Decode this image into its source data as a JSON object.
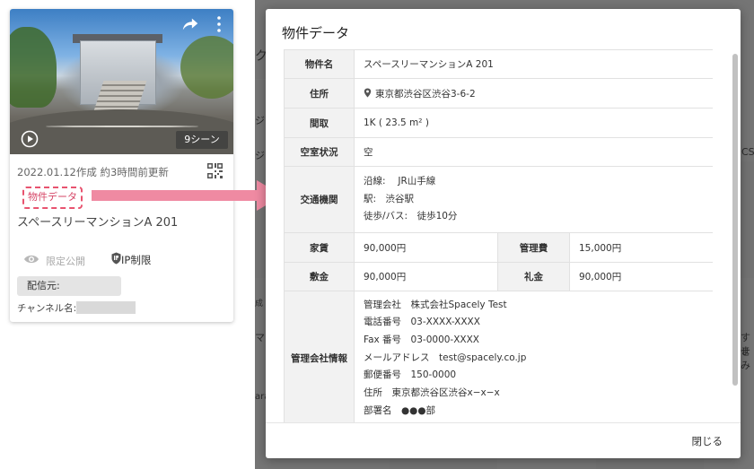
{
  "card": {
    "scene_count": "9シーン",
    "meta": "2022.01.12作成 約3時間前更新",
    "property_data_button": "物件データ",
    "title": "スペースリーマンションA 201",
    "visibility": "限定公開",
    "ip_restriction": "IP制限",
    "distributor_label": "配信元:",
    "channel_label": "チャンネル名:"
  },
  "background": {
    "fragments": [
      "ク",
      "ジェ",
      "ジェ",
      "CS",
      "成",
      "マ",
      "すせ",
      "まみ",
      "ararar"
    ]
  },
  "modal": {
    "title": "物件データ",
    "rows": {
      "name": {
        "label": "物件名",
        "value": "スペースリーマンションA 201"
      },
      "address": {
        "label": "住所",
        "value": "東京都渋谷区渋谷3-6-2"
      },
      "layout": {
        "label": "間取",
        "value": "1K ( 23.5 m² )"
      },
      "vacancy": {
        "label": "空室状況",
        "value": "空"
      },
      "transport": {
        "label": "交通機関",
        "lines": [
          "沿線:　 JR山手線",
          "駅:　渋谷駅",
          "徒歩/バス:　徒歩10分"
        ]
      },
      "rent": {
        "label": "家賃",
        "value": "90,000円"
      },
      "management_fee": {
        "label": "管理費",
        "value": "15,000円"
      },
      "deposit": {
        "label": "敷金",
        "value": "90,000円"
      },
      "key_money": {
        "label": "礼金",
        "value": "90,000円"
      },
      "company": {
        "label": "管理会社情報",
        "lines": [
          "管理会社　株式会社Spacely Test",
          "電話番号　03-XXXX-XXXX",
          "Fax 番号　03-0000-XXXX",
          "メールアドレス　test@spacely.co.jp",
          "郵便番号　150-0000",
          "住所　東京都渋谷区渋谷x−x−x",
          "部署名　●●●部"
        ]
      }
    },
    "close_label": "閉じる"
  },
  "colors": {
    "accent_pink": "#e8536f",
    "arrow_pink": "#ef8aa2",
    "header_cell_bg": "#f2f2f2",
    "overlay": "#5a5a5a"
  },
  "icons": [
    "share-icon",
    "more-vert-icon",
    "play-icon",
    "qr-code-icon",
    "eye-icon",
    "ip-lock-icon",
    "location-pin-icon"
  ]
}
